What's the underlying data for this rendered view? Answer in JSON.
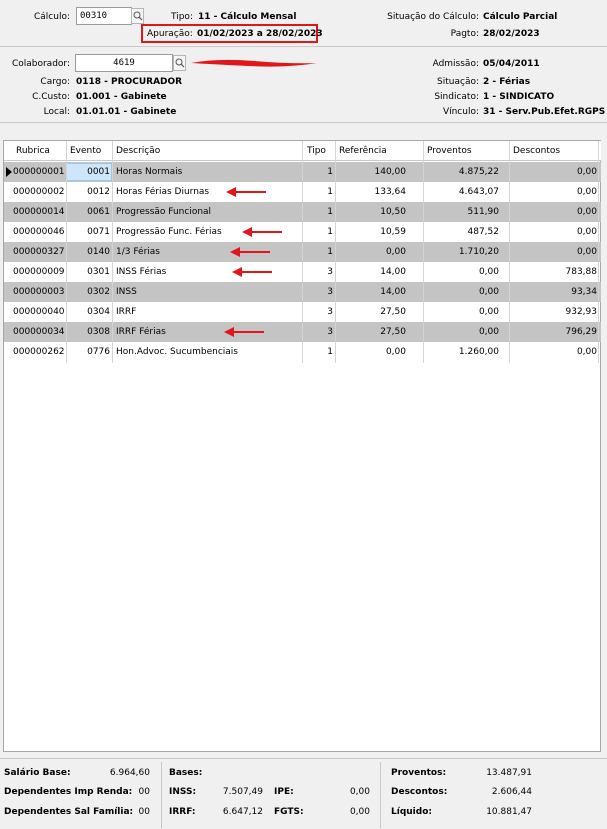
{
  "header": {
    "calculo_label": "Cálculo:",
    "calculo_value": "00310",
    "tipo_label": "Tipo:",
    "tipo_value": "11 - Cálculo Mensal",
    "apuracao_label": "Apuração:",
    "apuracao_value": "01/02/2023 a 28/02/2023",
    "situacao_calculo_label": "Situação do Cálculo:",
    "situacao_calculo_value": "Cálculo Parcial",
    "pagto_label": "Pagto:",
    "pagto_value": "28/02/2023"
  },
  "colaborador": {
    "label": "Colaborador:",
    "value": "4619",
    "cargo_label": "Cargo:",
    "cargo_value": "0118 - PROCURADOR",
    "ccusto_label": "C.Custo:",
    "ccusto_value": "01.001 - Gabinete",
    "local_label": "Local:",
    "local_value": "01.01.01 - Gabinete",
    "admissao_label": "Admissão:",
    "admissao_value": "05/04/2011",
    "situacao_label": "Situação:",
    "situacao_value": "2 - Férias",
    "sindicato_label": "Sindicato:",
    "sindicato_value": "1 - SINDICATO",
    "vinculo_label": "Vínculo:",
    "vinculo_value": "31 - Serv.Pub.Efet.RGPS"
  },
  "grid": {
    "columns": [
      "Rubrica",
      "Evento",
      "Descrição",
      "Tipo",
      "Referência",
      "Proventos",
      "Descontos"
    ],
    "rows": [
      {
        "rubrica": "000000001",
        "evento": "0001",
        "descricao": "Horas Normais",
        "tipo": "1",
        "referencia": "140,00",
        "proventos": "4.875,22",
        "descontos": "0,00",
        "arrow": false
      },
      {
        "rubrica": "000000002",
        "evento": "0012",
        "descricao": "Horas Férias Diurnas",
        "tipo": "1",
        "referencia": "133,64",
        "proventos": "4.643,07",
        "descontos": "0,00",
        "arrow": true
      },
      {
        "rubrica": "000000014",
        "evento": "0061",
        "descricao": "Progressão Funcional",
        "tipo": "1",
        "referencia": "10,50",
        "proventos": "511,90",
        "descontos": "0,00",
        "arrow": false
      },
      {
        "rubrica": "000000046",
        "evento": "0071",
        "descricao": "Progressão Func. Férias",
        "tipo": "1",
        "referencia": "10,59",
        "proventos": "487,52",
        "descontos": "0,00",
        "arrow": true
      },
      {
        "rubrica": "000000327",
        "evento": "0140",
        "descricao": "1/3 Férias",
        "tipo": "1",
        "referencia": "0,00",
        "proventos": "1.710,20",
        "descontos": "0,00",
        "arrow": true
      },
      {
        "rubrica": "000000009",
        "evento": "0301",
        "descricao": "INSS Férias",
        "tipo": "3",
        "referencia": "14,00",
        "proventos": "0,00",
        "descontos": "783,88",
        "arrow": true
      },
      {
        "rubrica": "000000003",
        "evento": "0302",
        "descricao": "INSS",
        "tipo": "3",
        "referencia": "14,00",
        "proventos": "0,00",
        "descontos": "93,34",
        "arrow": false
      },
      {
        "rubrica": "000000040",
        "evento": "0304",
        "descricao": "IRRF",
        "tipo": "3",
        "referencia": "27,50",
        "proventos": "0,00",
        "descontos": "932,93",
        "arrow": false
      },
      {
        "rubrica": "000000034",
        "evento": "0308",
        "descricao": "IRRF Férias",
        "tipo": "3",
        "referencia": "27,50",
        "proventos": "0,00",
        "descontos": "796,29",
        "arrow": true
      },
      {
        "rubrica": "000000262",
        "evento": "0776",
        "descricao": "Hon.Advoc. Sucumbenciais",
        "tipo": "1",
        "referencia": "0,00",
        "proventos": "1.260,00",
        "descontos": "0,00",
        "arrow": false
      }
    ]
  },
  "footer": {
    "salario_base_label": "Salário Base:",
    "salario_base_value": "6.964,60",
    "dep_ir_label": "Dependentes Imp Renda:",
    "dep_ir_value": "00",
    "dep_sf_label": "Dependentes Sal Família:",
    "dep_sf_value": "00",
    "bases_label": "Bases:",
    "inss_label": "INSS:",
    "inss_value": "7.507,49",
    "ipe_label": "IPE:",
    "ipe_value": "0,00",
    "irrf_label": "IRRF:",
    "irrf_value": "6.647,12",
    "fgts_label": "FGTS:",
    "fgts_value": "0,00",
    "proventos_label": "Proventos:",
    "proventos_value": "13.487,91",
    "descontos_label": "Descontos:",
    "descontos_value": "2.606,44",
    "liquido_label": "Líquido:",
    "liquido_value": "10.881,47"
  },
  "colors": {
    "annotation_red": "#e0161b",
    "row_alt": "#c4c4c4",
    "selected_cell": "#cde6fa"
  }
}
